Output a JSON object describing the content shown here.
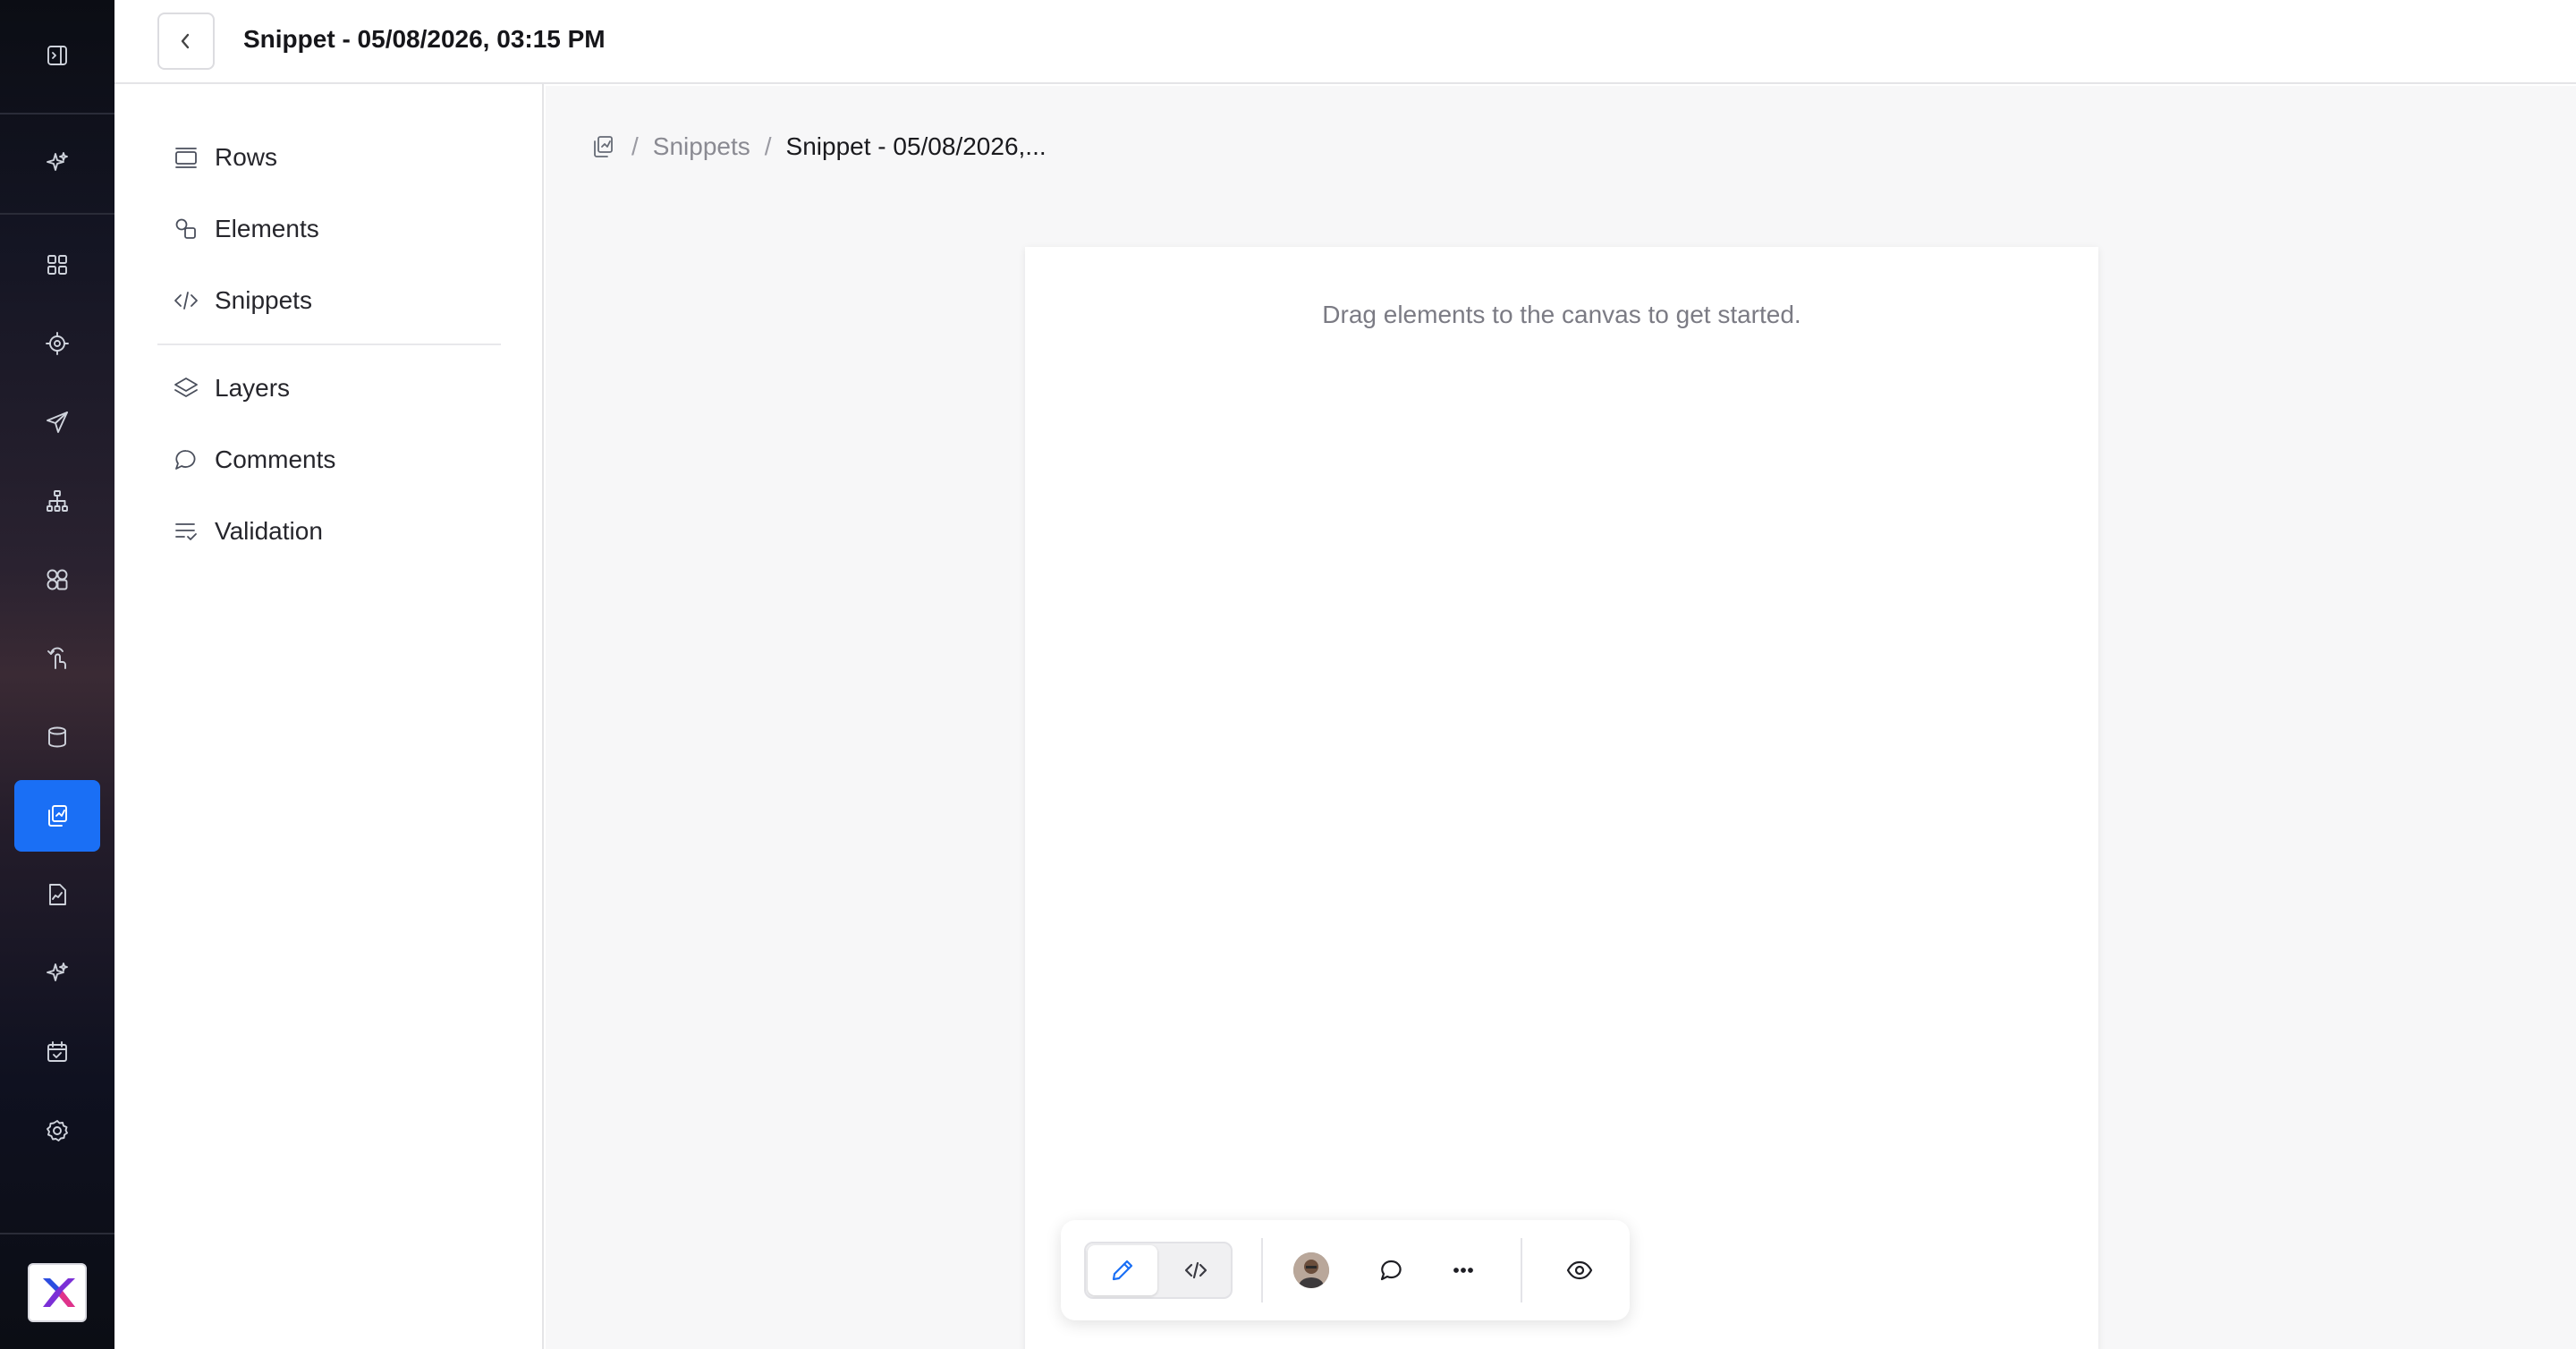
{
  "header": {
    "title": "Snippet - 05/08/2026, 03:15 PM"
  },
  "rail": {
    "items": [
      {
        "icon": "sidebar-toggle-icon"
      },
      {
        "icon": "sparkle-icon"
      },
      {
        "icon": "dashboard-grid-icon"
      },
      {
        "icon": "target-icon"
      },
      {
        "icon": "send-icon"
      },
      {
        "icon": "sitemap-icon"
      },
      {
        "icon": "components-icon"
      },
      {
        "icon": "touch-icon"
      },
      {
        "icon": "database-icon"
      },
      {
        "icon": "snippets-icon",
        "active": true
      },
      {
        "icon": "report-icon"
      },
      {
        "icon": "ai-sparkle-icon"
      },
      {
        "icon": "calendar-icon"
      },
      {
        "icon": "settings-icon"
      }
    ],
    "logo": "app-logo-icon"
  },
  "sidebar": {
    "items": [
      {
        "label": "Rows",
        "icon": "rows-icon"
      },
      {
        "label": "Elements",
        "icon": "elements-icon"
      },
      {
        "label": "Snippets",
        "icon": "code-icon"
      },
      {
        "label": "Layers",
        "icon": "layers-icon"
      },
      {
        "label": "Comments",
        "icon": "comment-icon"
      },
      {
        "label": "Validation",
        "icon": "validation-icon"
      }
    ]
  },
  "breadcrumb": {
    "icon": "snippets-icon",
    "separator": "/",
    "parent": "Snippets",
    "current": "Snippet - 05/08/2026,..."
  },
  "canvas": {
    "hint": "Drag elements to the canvas to get started."
  },
  "toolbar": {
    "modes": [
      {
        "icon": "pencil-icon",
        "active": true
      },
      {
        "icon": "code-icon",
        "active": false
      }
    ],
    "buttons": [
      "avatar",
      "comment-icon",
      "more-icon",
      "preview-eye-icon"
    ]
  },
  "colors": {
    "accent": "#1a6ff5",
    "rail_dark": "#0b0d14",
    "canvas_bg": "#f7f7f8"
  }
}
